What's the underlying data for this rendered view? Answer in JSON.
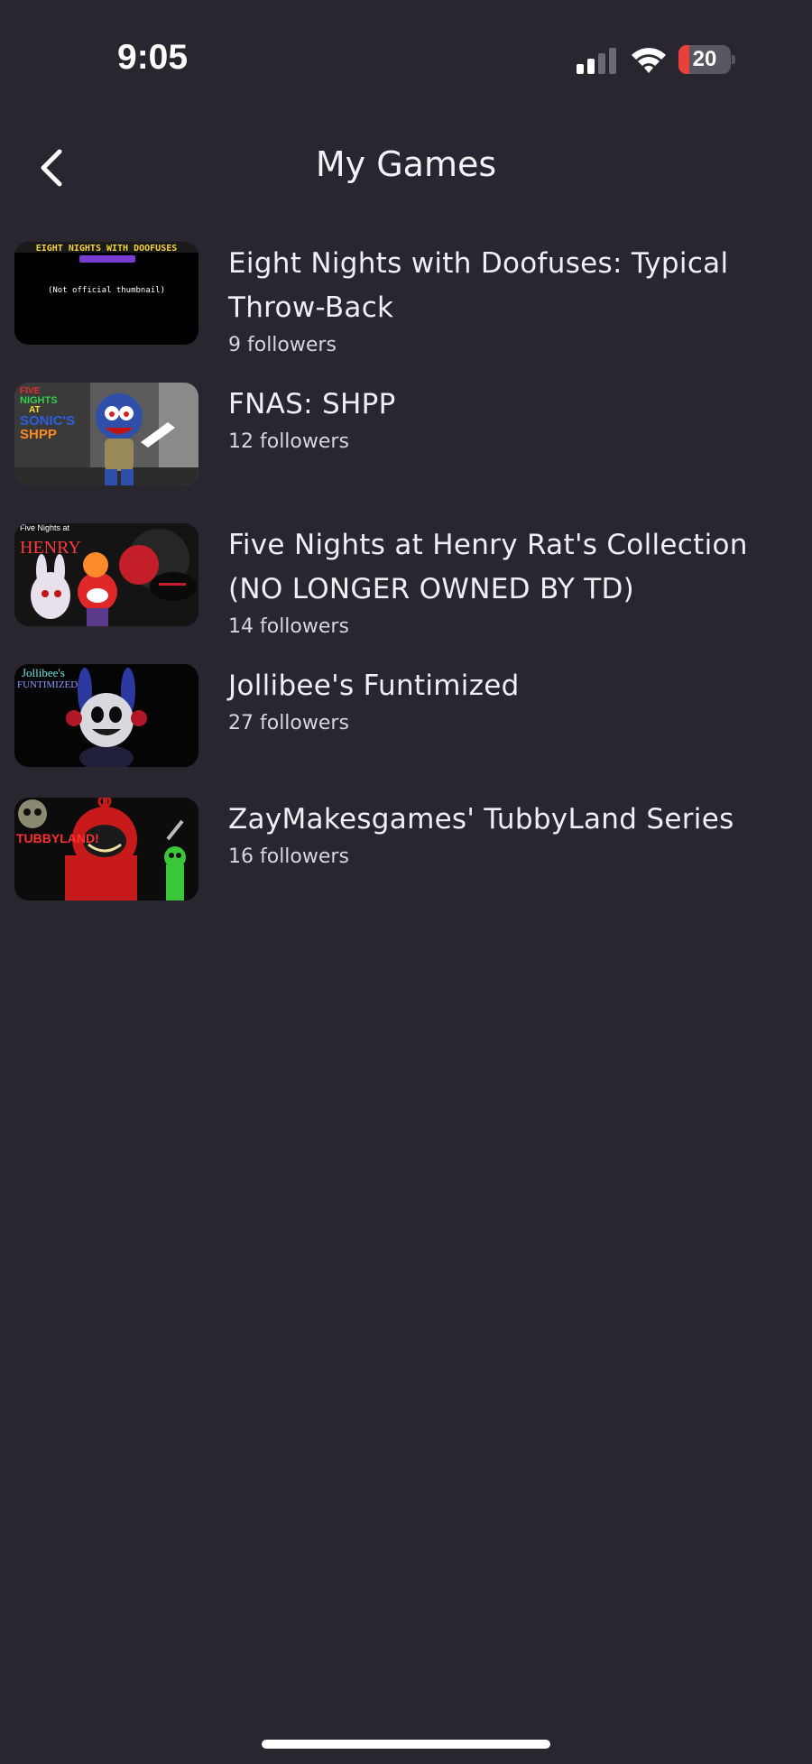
{
  "status_bar": {
    "time": "9:05",
    "battery_level": "20",
    "battery_fraction": 0.2,
    "icons": [
      "signal-icon",
      "wifi-icon",
      "battery-icon"
    ]
  },
  "header": {
    "title": "My Games",
    "back_icon": "chevron-left-icon"
  },
  "colors": {
    "background": "#2a2630",
    "text": "#f2f0f5",
    "battery_low": "#e8403a"
  },
  "games": [
    {
      "title": "Eight Nights with Doofuses: Typical Throw-Back",
      "followers": "9 followers",
      "thumbnail_lines": [
        "EIGHT NIGHTS WITH DOOFUSES",
        "(Not official thumbnail)"
      ]
    },
    {
      "title": "FNAS: SHPP",
      "followers": "12 followers",
      "thumbnail_lines": [
        "FIVE",
        "NIGHTS",
        "AT",
        "SONIC'S",
        "SHPP"
      ]
    },
    {
      "title": "Five Nights at Henry Rat's Collection (NO LONGER OWNED BY TD)",
      "followers": "14 followers",
      "thumbnail_lines": [
        "Five Nights at",
        "HENRY"
      ]
    },
    {
      "title": "Jollibee's Funtimized",
      "followers": "27 followers",
      "thumbnail_lines": [
        "Jollibee's",
        "FUNTIMIZED"
      ]
    },
    {
      "title": "ZayMakesgames' TubbyLand Series",
      "followers": "16 followers",
      "thumbnail_lines": [
        "TUBBYLAND!"
      ]
    }
  ]
}
